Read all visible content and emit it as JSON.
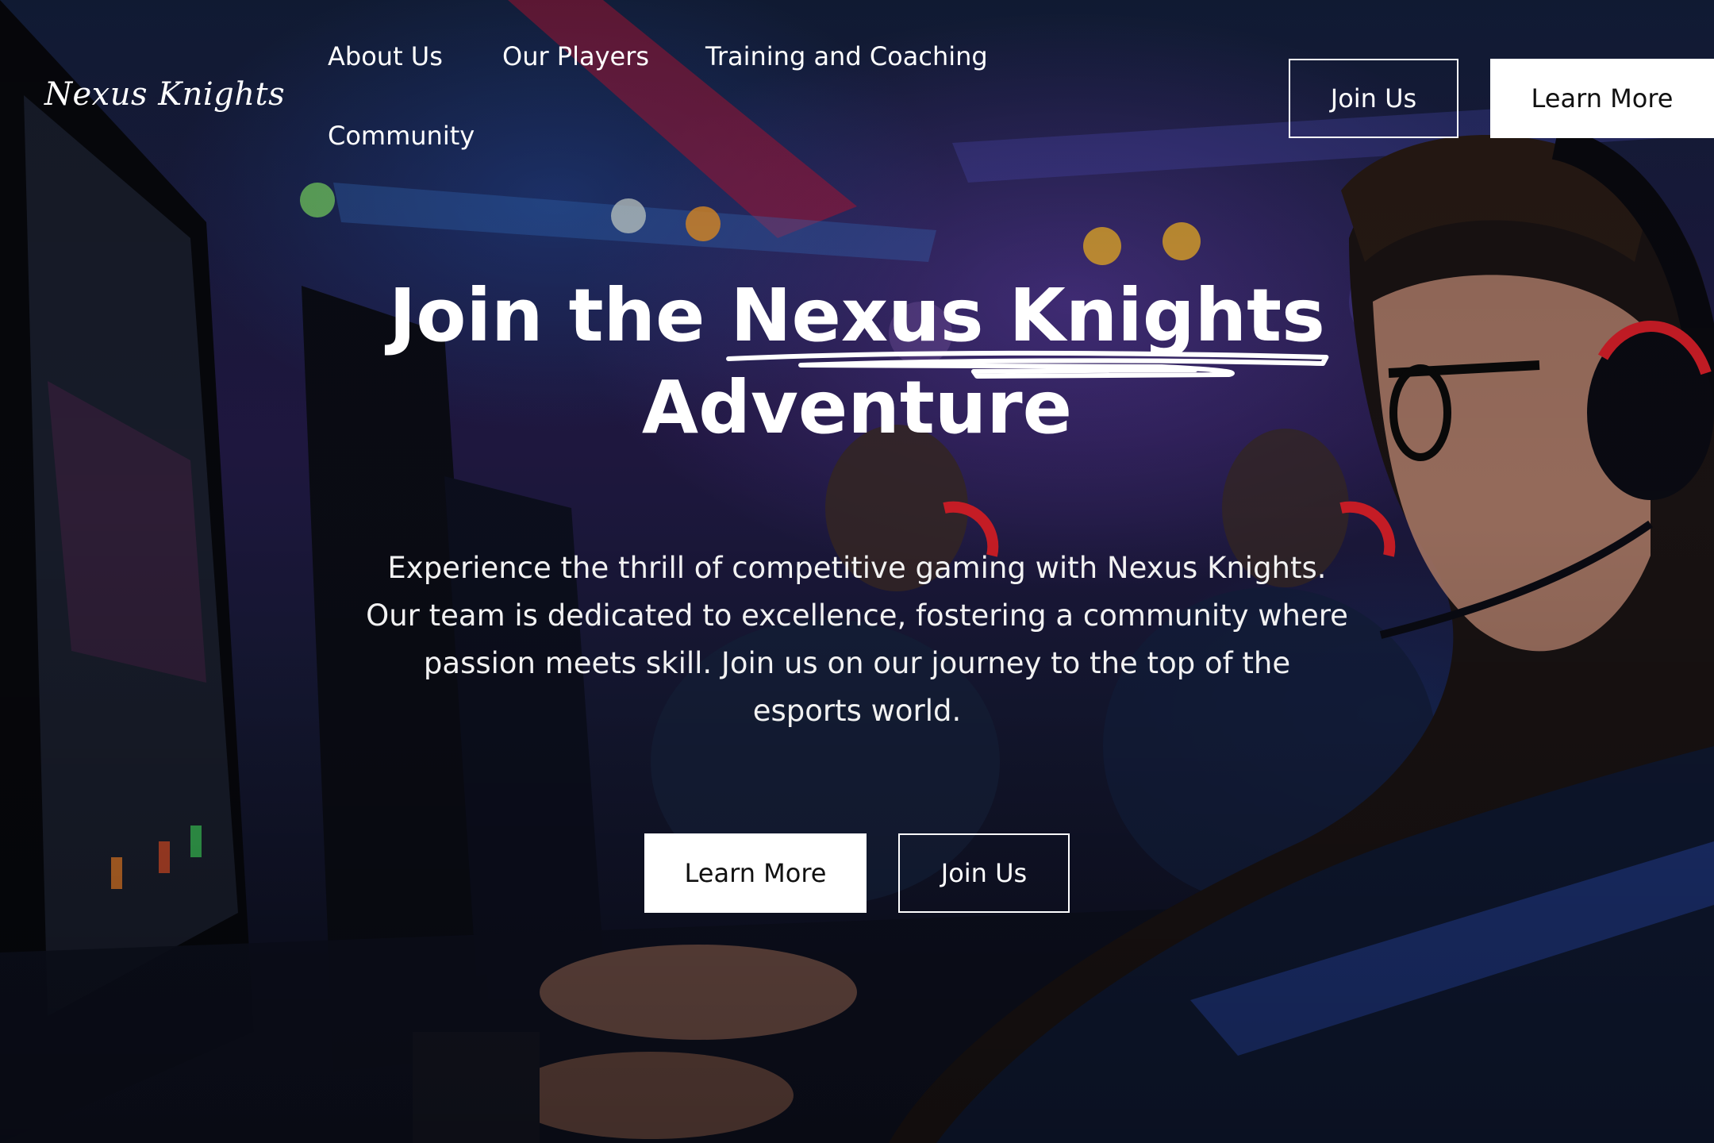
{
  "header": {
    "logo": "Nexus Knights",
    "nav": {
      "about": "About Us",
      "players": "Our Players",
      "training": "Training and Coaching",
      "community": "Community"
    },
    "join_label": "Join Us",
    "learn_label": "Learn More"
  },
  "hero": {
    "title_prefix": "Join the ",
    "title_highlight": "Nexus Knights",
    "title_suffix": "Adventure",
    "description": "Experience the thrill of competitive gaming with Nexus Knights. Our team is dedicated to excellence, fostering a community where passion meets skill. Join us on our journey to the top of the esports world.",
    "primary_label": "Learn More",
    "secondary_label": "Join Us"
  },
  "colors": {
    "text": "#ffffff",
    "button_solid_bg": "#ffffff",
    "button_solid_text": "#111111",
    "accent_red": "#e0202a"
  },
  "icons": {
    "title_underline": "brush-stroke-underline"
  }
}
